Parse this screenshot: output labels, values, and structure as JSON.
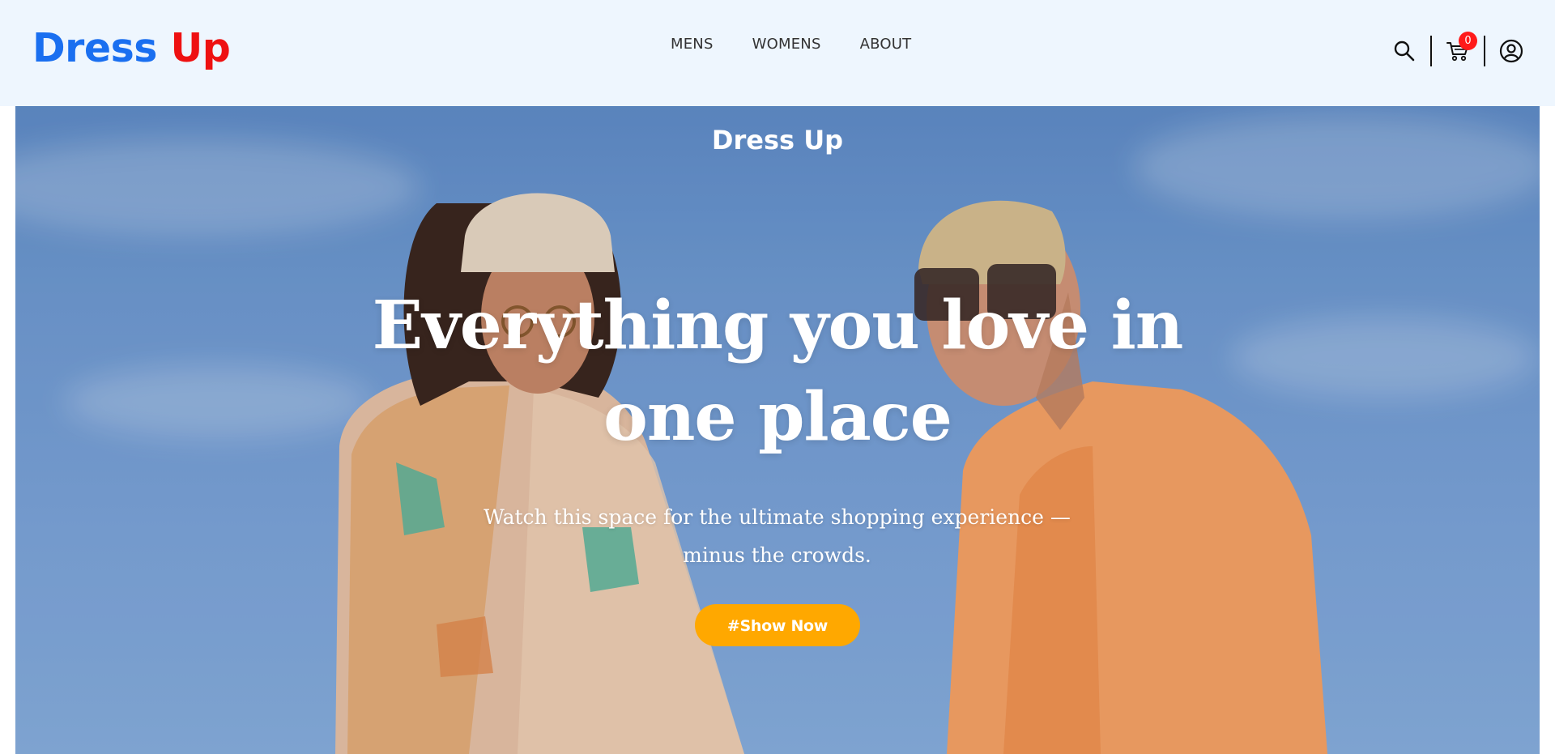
{
  "brand": {
    "word1": "Dress",
    "word2": "Up",
    "color_primary": "#1a6ff0",
    "color_accent": "#ee1111"
  },
  "nav": {
    "items": [
      {
        "label": "MENS"
      },
      {
        "label": "WOMENS"
      },
      {
        "label": "ABOUT"
      }
    ]
  },
  "header_icons": {
    "search": "search-icon",
    "cart": "cart-icon",
    "cart_count": "0",
    "account": "user-circle-icon",
    "badge_color": "#ff1a1a"
  },
  "hero": {
    "brand": "Dress Up",
    "title": "Everything you love in one place",
    "subtitle": "Watch this space for the ultimate shopping experience —minus the crowds.",
    "cta_label": "#Show Now",
    "cta_color": "#ffa800"
  }
}
